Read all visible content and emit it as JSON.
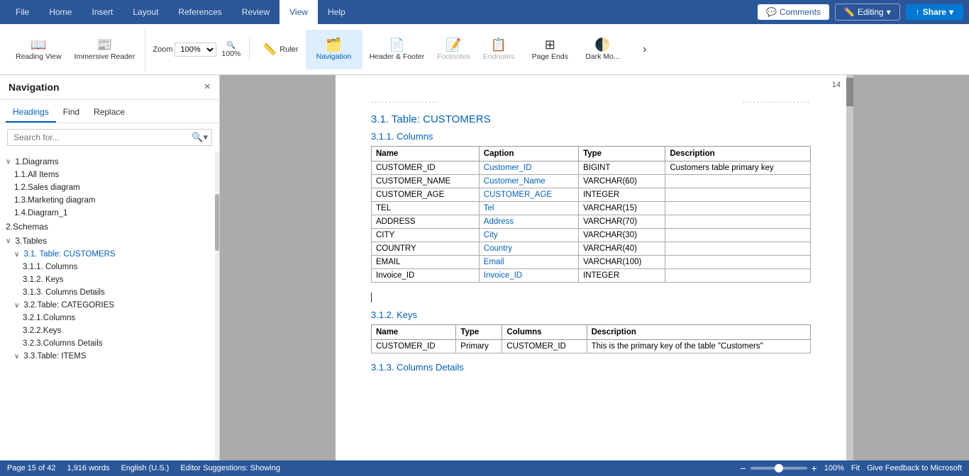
{
  "title_bar": {
    "tabs": [
      "File",
      "Home",
      "Insert",
      "Layout",
      "References",
      "Review",
      "View",
      "Help"
    ],
    "active_tab": "View",
    "comments_label": "Comments",
    "editing_label": "Editing",
    "share_label": "Share"
  },
  "ribbon": {
    "reading_view": "Reading View",
    "immersive_reader": "Immersive Reader",
    "zoom_label": "Zoom",
    "zoom_value": "100%",
    "zoom_pct": "100%",
    "ruler": "Ruler",
    "navigation": "Navigation",
    "header_footer": "Header & Footer",
    "footnotes": "Footnotes",
    "endnotes": "Endnotes",
    "page_ends": "Page Ends",
    "dark_mode": "Dark Mo..."
  },
  "nav_panel": {
    "title": "Navigation",
    "close_label": "×",
    "tabs": [
      "Headings",
      "Find",
      "Replace"
    ],
    "active_tab": "Headings",
    "search_placeholder": "Search for...",
    "items": [
      {
        "id": "diagrams",
        "level": 1,
        "label": "1.Diagrams",
        "expanded": true,
        "chevron": "∨"
      },
      {
        "id": "all-items",
        "level": 2,
        "label": "1.1.All Items"
      },
      {
        "id": "sales-diagram",
        "level": 2,
        "label": "1.2.Sales diagram"
      },
      {
        "id": "marketing-diagram",
        "level": 2,
        "label": "1.3.Marketing diagram"
      },
      {
        "id": "diagram-1",
        "level": 2,
        "label": "1.4.Diagram_1"
      },
      {
        "id": "schemas",
        "level": 1,
        "label": "2.Schemas"
      },
      {
        "id": "tables",
        "level": 1,
        "label": "3.Tables",
        "expanded": true,
        "chevron": "∨"
      },
      {
        "id": "customers",
        "level": 2,
        "label": "3.1. Table: CUSTOMERS",
        "active": true,
        "expanded": true,
        "chevron": "∨"
      },
      {
        "id": "columns",
        "level": 3,
        "label": "3.1.1. Columns"
      },
      {
        "id": "keys",
        "level": 3,
        "label": "3.1.2. Keys"
      },
      {
        "id": "columns-details",
        "level": 3,
        "label": "3.1.3. Columns Details"
      },
      {
        "id": "categories",
        "level": 2,
        "label": "3.2.Table: CATEGORIES",
        "expanded": true,
        "chevron": "∨"
      },
      {
        "id": "cat-columns",
        "level": 3,
        "label": "3.2.1.Columns"
      },
      {
        "id": "cat-keys",
        "level": 3,
        "label": "3.2.2.Keys"
      },
      {
        "id": "cat-columns-details",
        "level": 3,
        "label": "3.2.3.Columns Details"
      },
      {
        "id": "items-table",
        "level": 2,
        "label": "3.3.Table: ITEMS",
        "chevron": "∨"
      }
    ]
  },
  "doc": {
    "page_number_right": "14",
    "section_heading": "3.1. Table: CUSTOMERS",
    "sub_heading_1": "3.1.1. Columns",
    "columns_table": {
      "headers": [
        "Name",
        "Caption",
        "Type",
        "Description"
      ],
      "rows": [
        [
          "CUSTOMER_ID",
          "Customer_ID",
          "BIGINT",
          "Customers table primary key"
        ],
        [
          "CUSTOMER_NAME",
          "Customer_Name",
          "VARCHAR(60)",
          ""
        ],
        [
          "CUSTOMER_AGE",
          "CUSTOMER_AGE",
          "INTEGER",
          ""
        ],
        [
          "TEL",
          "Tel",
          "VARCHAR(15)",
          ""
        ],
        [
          "ADDRESS",
          "Address",
          "VARCHAR(70)",
          ""
        ],
        [
          "CITY",
          "City",
          "VARCHAR(30)",
          ""
        ],
        [
          "COUNTRY",
          "Country",
          "VARCHAR(40)",
          ""
        ],
        [
          "EMAIL",
          "Email",
          "VARCHAR(100)",
          ""
        ],
        [
          "Invoice_ID",
          "Invoice_ID",
          "INTEGER",
          ""
        ]
      ]
    },
    "sub_heading_2": "3.1.2. Keys",
    "keys_table": {
      "headers": [
        "Name",
        "Type",
        "Columns",
        "Description"
      ],
      "rows": [
        [
          "CUSTOMER_ID",
          "Primary",
          "CUSTOMER_ID",
          "This is the primary key of the table \"Customers\""
        ]
      ]
    },
    "sub_heading_3": "3.1.3. Columns Details"
  },
  "status_bar": {
    "page": "Page 15 of 42",
    "words": "1,916 words",
    "language": "English (U.S.)",
    "suggestions": "Editor Suggestions: Showing",
    "zoom_minus": "−",
    "zoom_plus": "+",
    "zoom_pct": "100%",
    "fit": "Fit",
    "feedback": "Give Feedback to Microsoft"
  }
}
